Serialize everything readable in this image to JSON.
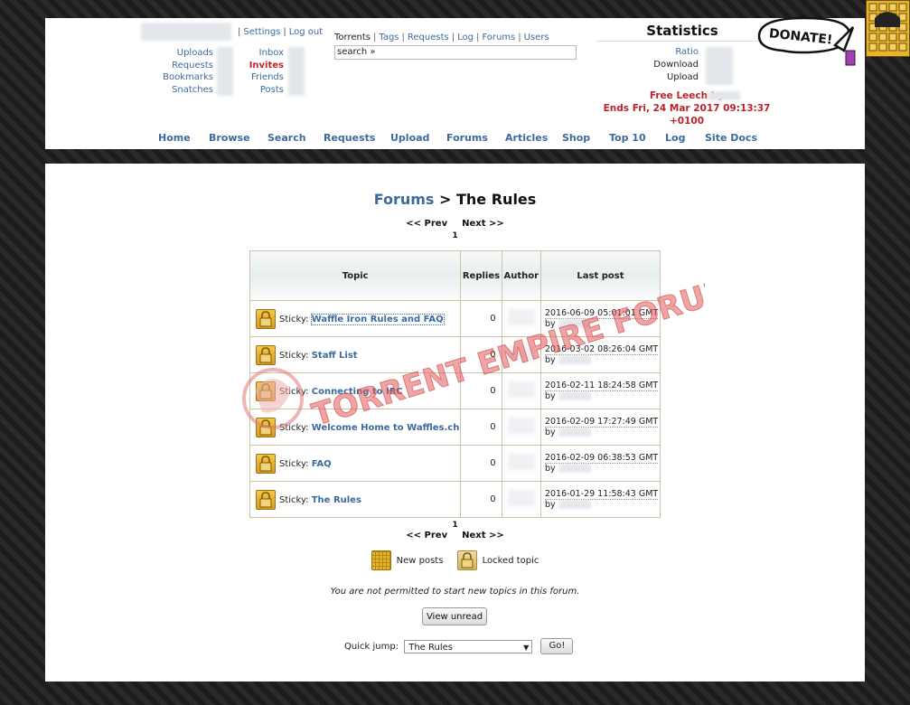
{
  "user": {
    "settings_label": "Settings",
    "logout_label": "Log out",
    "left_links": [
      "Uploads",
      "Requests",
      "Bookmarks",
      "Snatches"
    ],
    "mid_links": [
      "Inbox",
      "Invites",
      "Friends",
      "Posts"
    ]
  },
  "search": {
    "links": [
      "Torrents",
      "Tags",
      "Requests",
      "Log",
      "Forums",
      "Users"
    ],
    "input_value": "search »"
  },
  "stats": {
    "title": "Statistics",
    "ratio_label": "Ratio",
    "download_label": "Download",
    "upload_label": "Upload",
    "leech_line1": "Free Leech by",
    "leech_line2": "Ends Fri, 24 Mar 2017 09:13:37",
    "leech_line3": "+0100"
  },
  "donate": {
    "label": "DONATE!"
  },
  "nav": {
    "items": [
      "Home",
      "Browse",
      "Search",
      "Requests",
      "Upload",
      "Forums",
      "Articles",
      "Shop",
      "Top 10",
      "Log",
      "Site Docs"
    ]
  },
  "page": {
    "crumb": "Forums",
    "separator": ">",
    "title": "The Rules",
    "prev": "<< Prev",
    "next": "Next >>",
    "page_number": "1"
  },
  "table": {
    "headers": [
      "Topic",
      "Replies",
      "Author",
      "Last post"
    ],
    "sticky_prefix": "Sticky:",
    "by_label": "by",
    "rows": [
      {
        "title": "Waffle Iron Rules and FAQ",
        "replies": "0",
        "last_post": "2016-06-09 05:01:01 GMT"
      },
      {
        "title": "Staff List",
        "replies": "0",
        "last_post": "2016-03-02 08:26:04 GMT"
      },
      {
        "title": "Connecting to IRC",
        "replies": "0",
        "last_post": "2016-02-11 18:24:58 GMT"
      },
      {
        "title": "Welcome Home to Waffles.ch",
        "replies": "0",
        "last_post": "2016-02-09 17:27:49 GMT"
      },
      {
        "title": "FAQ",
        "replies": "0",
        "last_post": "2016-02-09 06:38:53 GMT"
      },
      {
        "title": "The Rules",
        "replies": "0",
        "last_post": "2016-01-29 11:58:43 GMT"
      }
    ]
  },
  "watermark": {
    "text": "TORRENT EMPIRE FORUM"
  },
  "legend": {
    "new_posts": "New posts",
    "locked_topic": "Locked topic"
  },
  "footer": {
    "no_permission": "You are not permitted to start new topics in this forum.",
    "view_unread": "View unread",
    "quick_jump_label": "Quick jump:",
    "quick_jump_value": "The Rules",
    "go_label": "Go!"
  },
  "colors": {
    "link": "#3d6a9c",
    "alert_red": "#c0222a",
    "table_border": "#c9c4a8",
    "icon_gold": "#e7b52a"
  }
}
